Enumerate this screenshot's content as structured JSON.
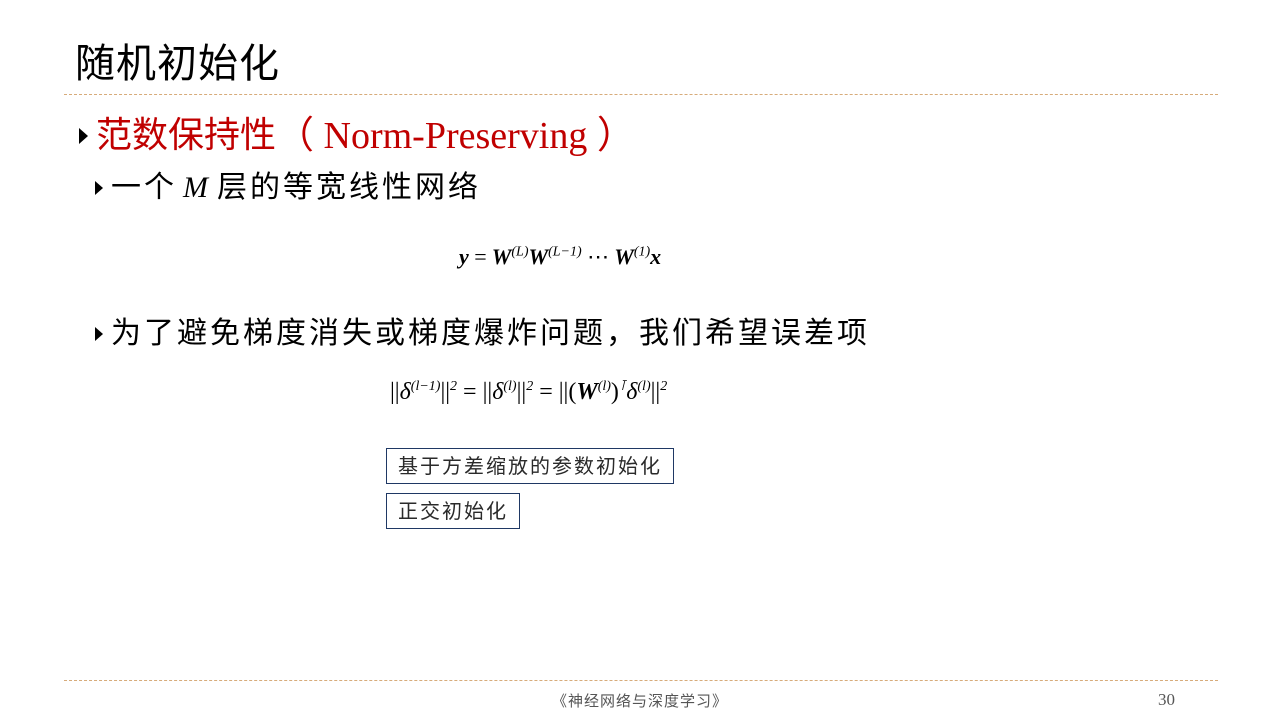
{
  "slide": {
    "title": "随机初始化",
    "heading_cn": "范数保持性",
    "heading_en": "（ Norm-Preserving ）",
    "bullet1_pre": "一个",
    "bullet1_var": "M",
    "bullet1_post": "层的等宽线性网络",
    "bullet2": "为了避免梯度消失或梯度爆炸问题，我们希望误差项",
    "box1": "基于方差缩放的参数初始化",
    "box2": "正交初始化",
    "footer": "《神经网络与深度学习》",
    "page_number": "30"
  },
  "equations": {
    "eq1": "y = W(L) W(L−1) ⋯ W(1) x",
    "eq2": "||δ(l−1)||² = ||δ(l)||² = ||(W(l))ᵀ δ(l)||²"
  },
  "colors": {
    "heading": "#c00000",
    "rule": "#d7ab7a",
    "box_border": "#1f3864"
  }
}
